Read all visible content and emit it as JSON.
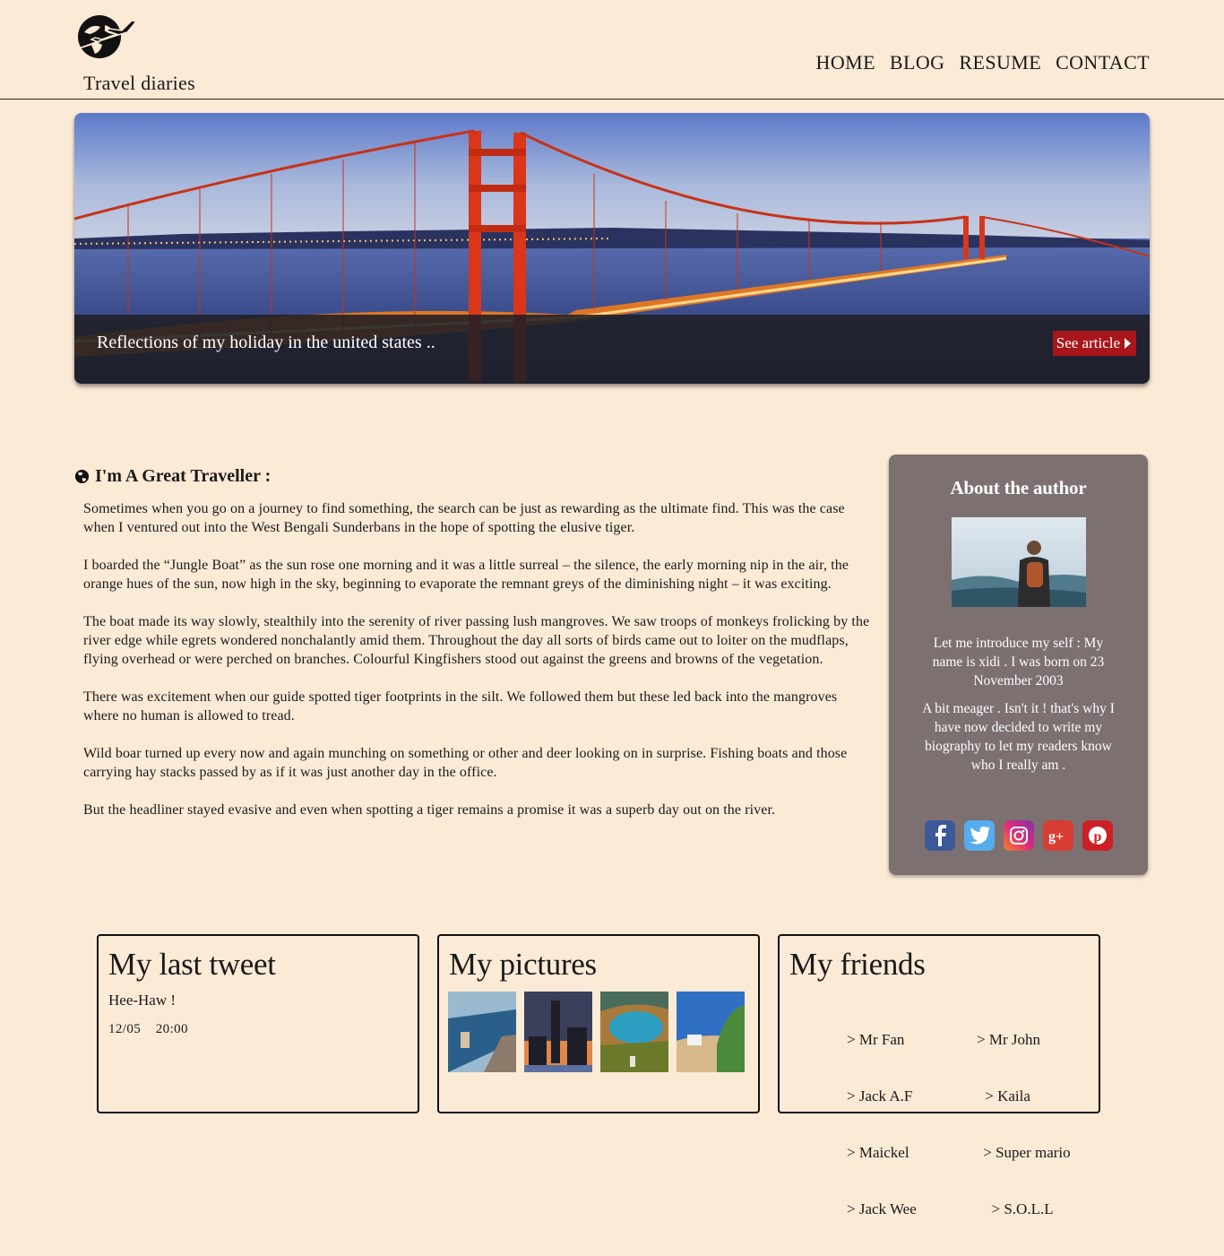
{
  "header": {
    "brand": "Travel diaries",
    "logo": "globe-airplane-icon",
    "nav": [
      "HOME",
      "BLOG",
      "RESUME",
      "CONTACT"
    ]
  },
  "hero": {
    "caption": "Reflections of my holiday in the united states ..",
    "button_label": "See article",
    "button_icon": "caret-right-icon"
  },
  "article": {
    "title": "I'm A Great Traveller :",
    "title_icon": "globe-icon",
    "paragraphs": [
      "Sometimes when you go on a journey to find something, the search can be just as rewarding as the ultimate find. This was the case when I ventured out into the West Bengali Sunderbans in the hope of spotting the elusive tiger.",
      "I boarded the “Jungle Boat” as the sun rose one morning and it was a little surreal – the silence, the early morning nip in the air, the orange hues of the sun, now high in the sky, beginning to evaporate the remnant greys of the diminishing night – it was exciting.",
      "The boat made its way slowly, stealthily into the serenity of river passing lush mangroves. We saw troops of monkeys frolicking by the river edge while egrets wondered nonchalantly amid them. Throughout the day all sorts of birds came out to loiter on the mudflaps, flying overhead or were perched on branches. Colourful Kingfishers stood out against the greens and browns of the vegetation.",
      "There was excitement when our guide spotted tiger footprints in the silt. We followed them but these led back into the mangroves where no human is allowed to tread.",
      "Wild boar turned up every now and again munching on something or other and deer looking on in surprise. Fishing boats and those carrying hay stacks passed by as if it was just another day in the office.",
      "But the headliner stayed evasive and even when spotting a tiger remains a promise it was a superb day out on the river."
    ]
  },
  "aside": {
    "title": "About the author",
    "bio1": "Let me introduce my self : My name is xidi . I was born on 23 November 2003",
    "bio2": "A bit meager . Isn't it ! that's why I have now decided to write my biography to let my readers know who I really am .",
    "social": [
      "facebook-icon",
      "twitter-icon",
      "instagram-icon",
      "google-plus-icon",
      "pinterest-icon"
    ]
  },
  "cards": {
    "tweet": {
      "title": "My last tweet",
      "text": "Hee-Haw !",
      "time": "12/05    20:00"
    },
    "pictures": {
      "title": "My pictures"
    },
    "friends": {
      "title": "My friends",
      "col1": [
        "> Mr Fan",
        "> Jack A.F",
        "> Maickel",
        "> Jack Wee"
      ],
      "col2": [
        "> Mr John",
        " > Kaila",
        " > Super mario",
        "  > S.O.L.L"
      ]
    }
  },
  "colors": {
    "background": "#fbead6",
    "sidebar": "#7d7070",
    "accent": "#a8161c"
  }
}
